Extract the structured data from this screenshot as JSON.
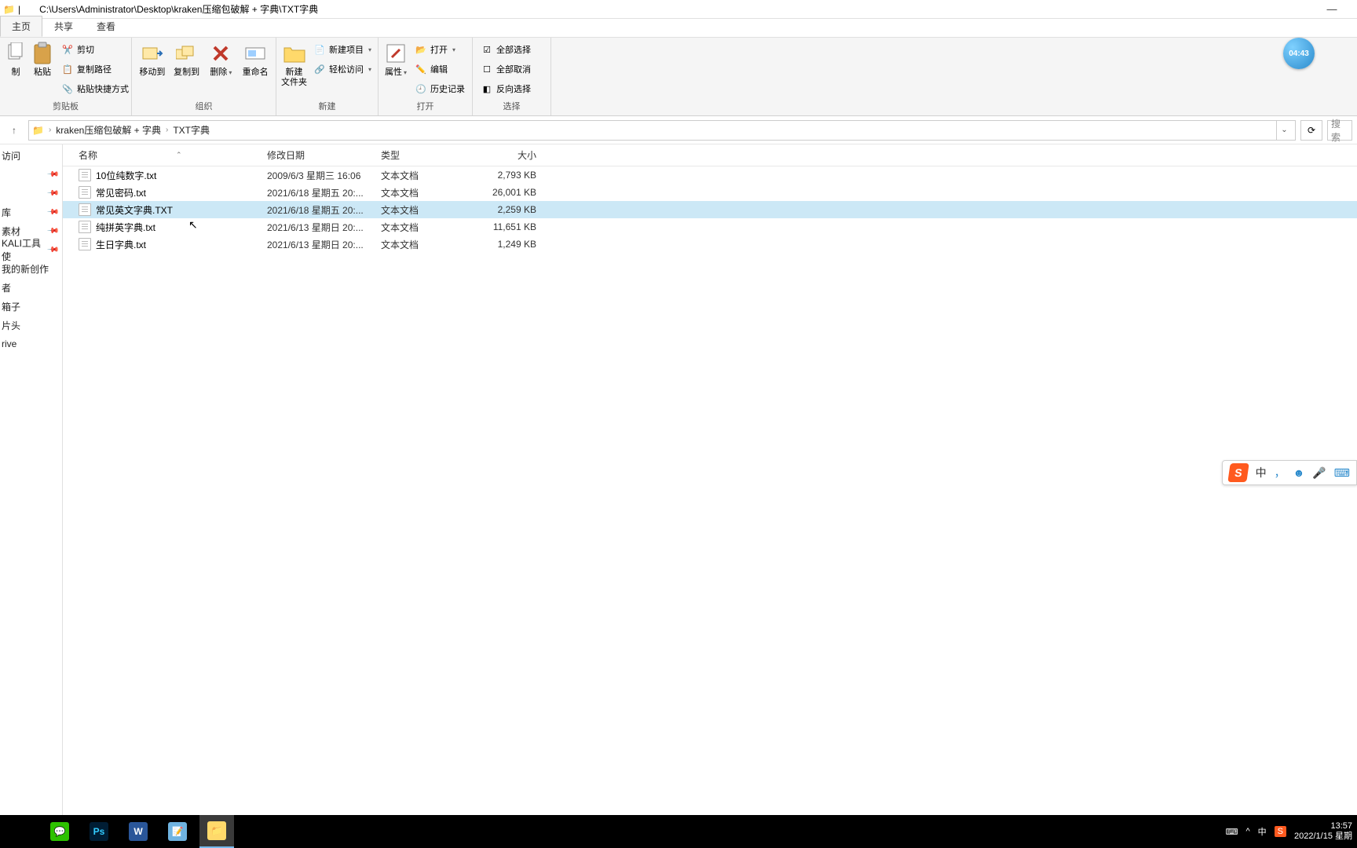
{
  "window": {
    "title_path": "C:\\Users\\Administrator\\Desktop\\kraken压缩包破解 + 字典\\TXT字典",
    "minimize": "—"
  },
  "tabs": {
    "home": "主页",
    "share": "共享",
    "view": "查看"
  },
  "ribbon": {
    "clipboard": {
      "copy_big": "制",
      "paste": "粘贴",
      "cut": "剪切",
      "copy_path": "复制路径",
      "paste_shortcut": "粘贴快捷方式",
      "group": "剪贴板"
    },
    "organize": {
      "move_to": "移动到",
      "copy_to": "复制到",
      "delete": "删除",
      "rename": "重命名",
      "group": "组织"
    },
    "new": {
      "new_folder": "新建\n文件夹",
      "new_item": "新建项目",
      "easy_access": "轻松访问",
      "group": "新建"
    },
    "open": {
      "properties": "属性",
      "open": "打开",
      "edit": "编辑",
      "history": "历史记录",
      "group": "打开"
    },
    "select": {
      "select_all": "全部选择",
      "select_none": "全部取消",
      "invert": "反向选择",
      "group": "选择"
    }
  },
  "breadcrumb": {
    "seg1": "kraken压缩包破解 + 字典",
    "seg2": "TXT字典",
    "search_placeholder": "搜索"
  },
  "columns": {
    "name": "名称",
    "date": "修改日期",
    "type": "类型",
    "size": "大小"
  },
  "files": [
    {
      "name": "10位纯数字.txt",
      "date": "2009/6/3 星期三 16:06",
      "type": "文本文档",
      "size": "2,793 KB",
      "selected": false
    },
    {
      "name": "常见密码.txt",
      "date": "2021/6/18 星期五 20:...",
      "type": "文本文档",
      "size": "26,001 KB",
      "selected": false
    },
    {
      "name": "常见英文字典.TXT",
      "date": "2021/6/18 星期五 20:...",
      "type": "文本文档",
      "size": "2,259 KB",
      "selected": true
    },
    {
      "name": "纯拼英字典.txt",
      "date": "2021/6/13 星期日 20:...",
      "type": "文本文档",
      "size": "11,651 KB",
      "selected": false
    },
    {
      "name": "生日字典.txt",
      "date": "2021/6/13 星期日 20:...",
      "type": "文本文档",
      "size": "1,249 KB",
      "selected": false
    }
  ],
  "sidebar": [
    {
      "label": "访问",
      "pin": false
    },
    {
      "label": "",
      "pin": true
    },
    {
      "label": "",
      "pin": true
    },
    {
      "label": "库",
      "pin": true
    },
    {
      "label": "素材",
      "pin": true
    },
    {
      "label": "KALI工具使",
      "pin": true
    },
    {
      "label": "我的新创作",
      "pin": false
    },
    {
      "label": "者",
      "pin": false
    },
    {
      "label": "箱子",
      "pin": false
    },
    {
      "label": "片头",
      "pin": false
    },
    {
      "label": "rive",
      "pin": false
    },
    {
      "label": "",
      "pin": false
    }
  ],
  "clock_overlay": "04:43",
  "ime": {
    "zhong": "中",
    "comma": "，",
    "face": "☻",
    "mic": "🎤",
    "kbd": "⌨"
  },
  "tray": {
    "touchpad": "⌨",
    "up": "^",
    "zhong": "中",
    "s": "S",
    "time": "13:57",
    "date": "2022/1/15 星期"
  }
}
